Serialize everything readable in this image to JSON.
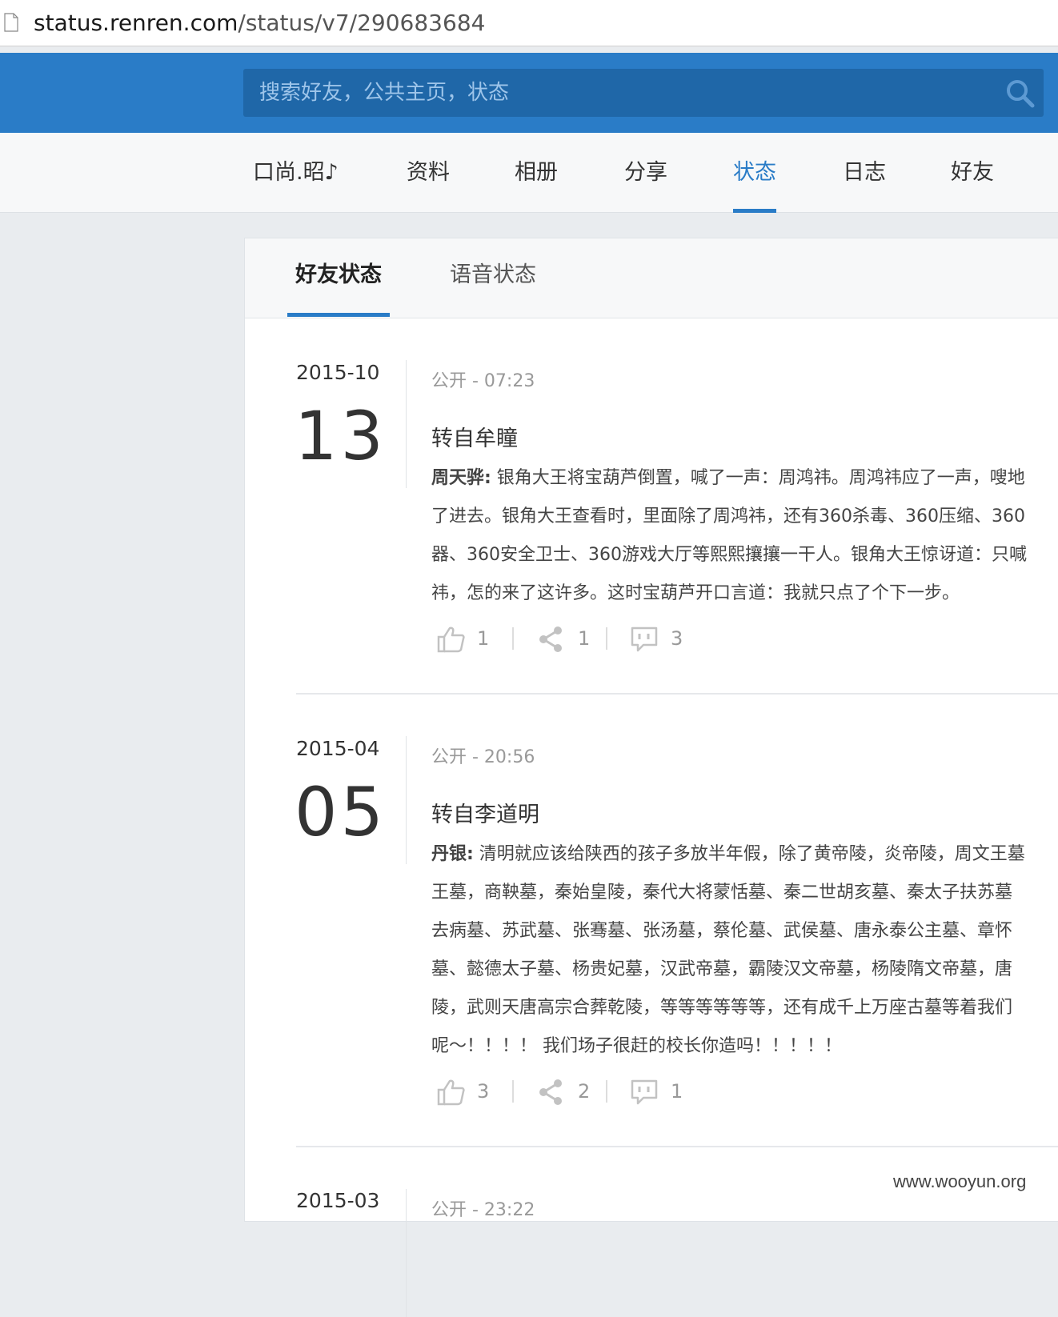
{
  "browser": {
    "url_host": "status.renren.com",
    "url_path": "/status/v7/290683684"
  },
  "search": {
    "placeholder": "搜索好友，公共主页，状态"
  },
  "nav": {
    "items": [
      {
        "label": "口尚.昭♪"
      },
      {
        "label": "资料"
      },
      {
        "label": "相册"
      },
      {
        "label": "分享"
      },
      {
        "label": "状态",
        "active": true
      },
      {
        "label": "日志"
      },
      {
        "label": "好友"
      }
    ]
  },
  "tabs": [
    {
      "label": "好友状态",
      "active": true
    },
    {
      "label": "语音状态"
    }
  ],
  "entries": [
    {
      "month": "2015-10",
      "day": "13",
      "meta": "公开 - 07:23",
      "title": "转自牟瞳",
      "author": "周天骅:",
      "lines": [
        " 银角大王将宝葫芦倒置，喊了一声：周鸿祎。周鸿祎应了一声，嗖地",
        "了进去。银角大王查看时，里面除了周鸿祎，还有360杀毒、360压缩、360",
        "器、360安全卫士、360游戏大厅等熙熙攘攘一干人。银角大王惊讶道：只喊",
        "祎，怎的来了这许多。这时宝葫芦开口言道：我就只点了个下一步。"
      ],
      "likes": "1",
      "shares": "1",
      "comments": "3"
    },
    {
      "month": "2015-04",
      "day": "05",
      "meta": "公开 - 20:56",
      "title": "转自李道明",
      "author": "丹银:",
      "lines": [
        " 清明就应该给陕西的孩子多放半年假，除了黄帝陵，炎帝陵，周文王墓",
        "王墓，商鞅墓，秦始皇陵，秦代大将蒙恬墓、秦二世胡亥墓、秦太子扶苏墓",
        "去病墓、苏武墓、张骞墓、张汤墓，蔡伦墓、武侯墓、唐永泰公主墓、章怀",
        "墓、懿德太子墓、杨贵妃墓，汉武帝墓，霸陵汉文帝墓，杨陵隋文帝墓，唐",
        "陵，武则天唐高宗合葬乾陵，等等等等等等，还有成千上万座古墓等着我们",
        "呢～！！！！ 我们场子很赶的校长你造吗！！！！！"
      ],
      "likes": "3",
      "shares": "2",
      "comments": "1"
    },
    {
      "month": "2015-03",
      "meta": "公开 - 23:22"
    }
  ],
  "watermark": "www.wooyun.org"
}
